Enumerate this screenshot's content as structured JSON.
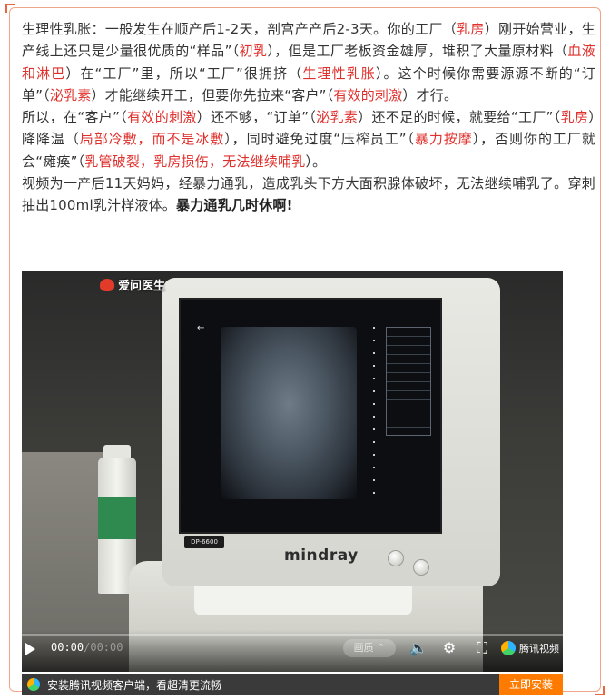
{
  "article": {
    "para1": [
      {
        "text": "生理性乳胀：一般发生在顺产后1-2天，剖宫产产后2-3天。你的工厂（",
        "red": false
      },
      {
        "text": "乳房",
        "red": true
      },
      {
        "text": "）刚开始营业，生产线上还只是少量很优质的“样品”（",
        "red": false
      },
      {
        "text": "初乳",
        "red": true
      },
      {
        "text": "），但是工厂老板资金雄厚，堆积了大量原材料（",
        "red": false
      },
      {
        "text": "血液和淋巴",
        "red": true
      },
      {
        "text": "）在“工厂”里，所以“工厂”很拥挤（",
        "red": false
      },
      {
        "text": "生理性乳胀",
        "red": true
      },
      {
        "text": "）。这个时候你需要源源不断的“订单”（",
        "red": false
      },
      {
        "text": "泌乳素",
        "red": true
      },
      {
        "text": "）才能继续开工，但要你先拉来“客户”（",
        "red": false
      },
      {
        "text": "有效的刺激",
        "red": true
      },
      {
        "text": "）才行。",
        "red": false
      }
    ],
    "para2": [
      {
        "text": "所以，在“客户”（",
        "red": false
      },
      {
        "text": "有效的刺激",
        "red": true
      },
      {
        "text": "）还不够，“订单”（",
        "red": false
      },
      {
        "text": "泌乳素",
        "red": true
      },
      {
        "text": "）还不足的时候，就要给“工厂”（",
        "red": false
      },
      {
        "text": "乳房",
        "red": true
      },
      {
        "text": "）降降温（",
        "red": false
      },
      {
        "text": "局部冷敷，而不是冰敷",
        "red": true
      },
      {
        "text": "），同时避免过度“压榨员工”（",
        "red": false
      },
      {
        "text": "暴力按摩",
        "red": true
      },
      {
        "text": "），否则你的工厂就会“瘫痪”（",
        "red": false
      },
      {
        "text": "乳管破裂，乳房损伤，无法继续哺乳",
        "red": true
      },
      {
        "text": "）。",
        "red": false
      }
    ],
    "para3_text": "视频为一产后11天妈妈，经暴力通乳，造成乳头下方大面积腺体破坏，无法继续哺乳了。穿刺抽出100ml乳汁样液体。",
    "para3_bold": "暴力通乳几时休啊!"
  },
  "video": {
    "watermark": "爱问医生",
    "brand_label": "mindray",
    "model_tag": "DP-6600",
    "current_time": "00:00",
    "total_time": "00:00",
    "progress": 0,
    "quality_label": "画质",
    "provider_label": "腾讯视频",
    "colors": {
      "progress": "#ff8a00",
      "accent": "#e0302c"
    }
  },
  "install_bar": {
    "text": "安装腾讯视频客户端，看超清更流畅",
    "button_label": "立即安装"
  },
  "icons": {
    "play": "play-icon",
    "volume": "volume-icon",
    "settings": "gear-icon",
    "fullscreen": "fullscreen-icon",
    "tencent": "tencent-video-logo"
  }
}
